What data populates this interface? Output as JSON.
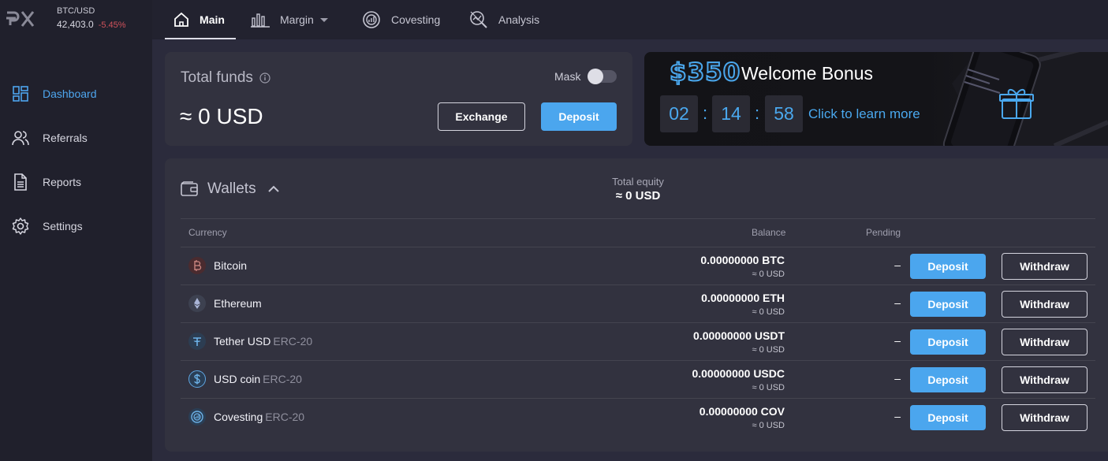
{
  "ticker": {
    "pair": "BTC/USD",
    "price": "42,403.0",
    "change": "-5.45%"
  },
  "nav": {
    "tabs": [
      {
        "label": "Main",
        "icon": "home-icon",
        "active": true
      },
      {
        "label": "Margin",
        "icon": "bar-chart-icon",
        "dropdown": true
      },
      {
        "label": "Covesting",
        "icon": "covesting-icon"
      },
      {
        "label": "Analysis",
        "icon": "analysis-icon"
      }
    ]
  },
  "sidebar": {
    "items": [
      {
        "label": "Dashboard",
        "icon": "dashboard-icon",
        "active": true
      },
      {
        "label": "Referrals",
        "icon": "users-icon"
      },
      {
        "label": "Reports",
        "icon": "document-icon"
      },
      {
        "label": "Settings",
        "icon": "gear-icon"
      }
    ]
  },
  "funds": {
    "title": "Total funds",
    "amount": "≈ 0 USD",
    "mask_label": "Mask",
    "mask_enabled": false,
    "exchange_label": "Exchange",
    "deposit_label": "Deposit"
  },
  "banner": {
    "amount": "$350",
    "title": "Welcome Bonus",
    "timer": [
      "02",
      "14",
      "58"
    ],
    "separator": ":",
    "link": "Click to learn more"
  },
  "wallets": {
    "title": "Wallets",
    "equity_label": "Total equity",
    "equity_value": "≈ 0 USD",
    "columns": {
      "currency": "Currency",
      "balance": "Balance",
      "pending": "Pending"
    },
    "deposit_label": "Deposit",
    "withdraw_label": "Withdraw",
    "rows": [
      {
        "name": "Bitcoin",
        "network": "",
        "icon": "bitcoin-icon",
        "balance": "0.00000000 BTC",
        "usd": "≈ 0 USD",
        "pending": "–"
      },
      {
        "name": "Ethereum",
        "network": "",
        "icon": "ethereum-icon",
        "balance": "0.00000000 ETH",
        "usd": "≈ 0 USD",
        "pending": "–"
      },
      {
        "name": "Tether USD",
        "network": "ERC-20",
        "icon": "tether-icon",
        "balance": "0.00000000 USDT",
        "usd": "≈ 0 USD",
        "pending": "–"
      },
      {
        "name": "USD coin",
        "network": "ERC-20",
        "icon": "usd-coin-icon",
        "balance": "0.00000000 USDC",
        "usd": "≈ 0 USD",
        "pending": "–"
      },
      {
        "name": "Covesting",
        "network": "ERC-20",
        "icon": "covesting-coin-icon",
        "balance": "0.00000000 COV",
        "usd": "≈ 0 USD",
        "pending": "–"
      }
    ]
  },
  "colors": {
    "accent": "#4ba6ee",
    "negative": "#d0525b",
    "background": "#2b2b3c",
    "card": "#32323f"
  }
}
